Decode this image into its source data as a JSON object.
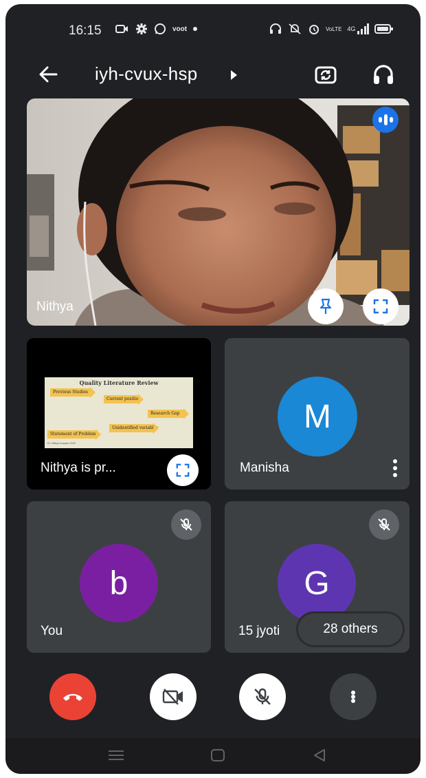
{
  "status_bar": {
    "time": "16:15",
    "left_icons": [
      "screen-record-icon",
      "settings-icon",
      "whatsapp-icon",
      "voot-app-icon",
      "dot-icon"
    ],
    "voot_label": "voot",
    "right_icons": [
      "headset-icon",
      "mute-ring-icon",
      "alarm-icon",
      "volte-icon",
      "signal-icon",
      "battery-icon"
    ],
    "volte_label": "VoLTE",
    "network_label": "4G"
  },
  "app_bar": {
    "meeting_code": "iyh-cvux-hsp",
    "icons": [
      "back-arrow-icon",
      "meeting-details-caret-icon",
      "switch-camera-icon",
      "audio-output-icon"
    ]
  },
  "main_speaker": {
    "name": "Nithya",
    "speaking": true,
    "actions": [
      "pin-icon",
      "fullscreen-icon"
    ]
  },
  "participants": [
    {
      "id": "presentation",
      "label": "Nithya is pr...",
      "slide": {
        "title": "Quality Literature Review",
        "boxes": [
          "Previous Studies",
          "Current position",
          "Research Gap",
          "Unidentified variables",
          "Statement of Problem"
        ],
        "footer": "Dr. Nithya Kaplan 2020"
      }
    },
    {
      "id": "manisha",
      "name": "Manisha",
      "initial": "M",
      "color": "#1a88d4",
      "muted": false,
      "has_menu": true
    },
    {
      "id": "you",
      "name": "You",
      "initial": "b",
      "color": "#7b1fa2",
      "muted": true
    },
    {
      "id": "jyoti",
      "name": "15 jyoti",
      "initial": "G",
      "color": "#5e35b1",
      "muted": true
    }
  ],
  "others_chip": "28 others",
  "controls": {
    "end_call_color": "#ea4335",
    "buttons": [
      "end-call-icon",
      "camera-off-icon",
      "mic-off-icon",
      "more-options-icon"
    ]
  }
}
